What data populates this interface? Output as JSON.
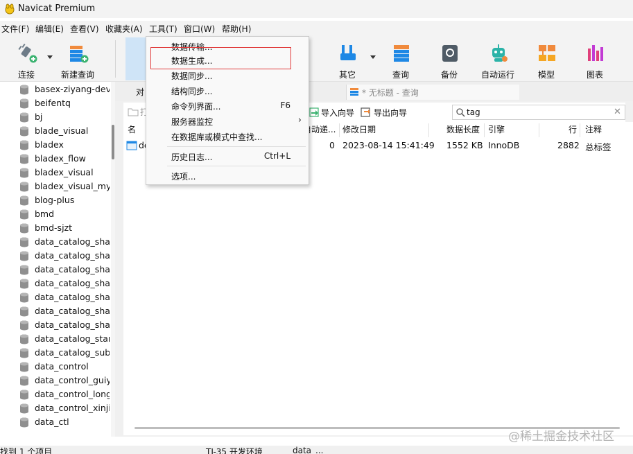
{
  "window": {
    "title": "Navicat Premium"
  },
  "menubar": {
    "items": [
      "文件(F)",
      "编辑(E)",
      "查看(V)",
      "收藏夹(A)",
      "工具(T)",
      "窗口(W)",
      "帮助(H)"
    ]
  },
  "toolbar": {
    "connect": "连接",
    "new_query": "新建查询",
    "other": "其它",
    "query": "查询",
    "backup": "备份",
    "auto_run": "自动运行",
    "model": "模型",
    "chart": "图表"
  },
  "tools_menu": {
    "items": [
      {
        "label": "数据传输...",
        "shortcut": ""
      },
      {
        "label": "数据生成...",
        "shortcut": ""
      },
      {
        "label": "数据同步...",
        "shortcut": ""
      },
      {
        "label": "结构同步...",
        "shortcut": ""
      },
      {
        "label": "命令列界面...",
        "shortcut": "F6"
      },
      {
        "label": "服务器监控",
        "shortcut": "",
        "submenu": true
      },
      {
        "label": "在数据库或模式中查找...",
        "shortcut": ""
      },
      {
        "label": "历史日志...",
        "shortcut": "Ctrl+L"
      },
      {
        "label": "选项...",
        "shortcut": ""
      }
    ],
    "highlighted_item": "数据生成..."
  },
  "navigator": {
    "databases": [
      "basex-ziyang-dev",
      "beifentq",
      "bj",
      "blade_visual",
      "bladex",
      "bladex_flow",
      "bladex_visual",
      "bladex_visual_mysql",
      "blog-plus",
      "bmd",
      "bmd-sjzt",
      "data_catalog_share",
      "data_catalog_share",
      "data_catalog_share",
      "data_catalog_share",
      "data_catalog_share",
      "data_catalog_share",
      "data_catalog_share",
      "data_catalog_standard",
      "data_catalog_subsys",
      "data_control",
      "data_control_guiyang",
      "data_control_longgang",
      "data_control_xinjiang",
      "data_ctl"
    ]
  },
  "tabs": {
    "objects": "对",
    "query": "* 无标题 - 查询"
  },
  "objects_toolbar": {
    "open": "打",
    "import": "导入向导",
    "export": "导出向导",
    "search_value": "tag"
  },
  "grid": {
    "columns": [
      "名",
      "自动递...",
      "修改日期",
      "数据长度",
      "引擎",
      "行",
      "注释"
    ],
    "rows": [
      {
        "name": "de",
        "auto_inc": "0",
        "modified": "2023-08-14 15:41:49",
        "data_length": "1552 KB",
        "engine": "InnoDB",
        "rows": "2882",
        "comment": "总标签"
      }
    ]
  },
  "statusbar": {
    "text": "找到 1 个项目",
    "connection": "TJ-35 开发环境",
    "database": "data_..."
  },
  "watermark": "@稀土掘金技术社区",
  "colors": {
    "accent": "#1e88e5",
    "highlight_red": "#e03a3a",
    "menu_bg": "#f9f9f9"
  }
}
